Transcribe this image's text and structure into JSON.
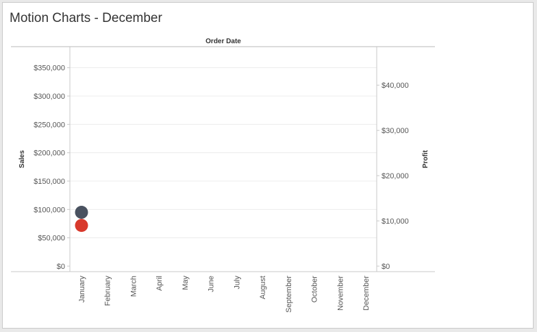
{
  "dashboard": {
    "title": "Motion Charts - December"
  },
  "chart_data": {
    "type": "scatter",
    "title": "",
    "top_label": "Order Date",
    "xlabel": "",
    "ylabel": "Sales",
    "y2label": "Profit",
    "categories": [
      "January",
      "February",
      "March",
      "April",
      "May",
      "June",
      "July",
      "August",
      "September",
      "October",
      "November",
      "December"
    ],
    "ylim": [
      0,
      375000
    ],
    "y2lim": [
      0,
      47000
    ],
    "y_ticks": [
      {
        "value": 0,
        "label": "$0"
      },
      {
        "value": 50000,
        "label": "$50,000"
      },
      {
        "value": 100000,
        "label": "$100,000"
      },
      {
        "value": 150000,
        "label": "$150,000"
      },
      {
        "value": 200000,
        "label": "$200,000"
      },
      {
        "value": 250000,
        "label": "$250,000"
      },
      {
        "value": 300000,
        "label": "$300,000"
      },
      {
        "value": 350000,
        "label": "$350,000"
      }
    ],
    "y2_ticks": [
      {
        "value": 0,
        "label": "$0"
      },
      {
        "value": 10000,
        "label": "$10,000"
      },
      {
        "value": 20000,
        "label": "$20,000"
      },
      {
        "value": 30000,
        "label": "$30,000"
      },
      {
        "value": 40000,
        "label": "$40,000"
      }
    ],
    "grid": true,
    "series": [
      {
        "measure": "Sales",
        "axis": "left",
        "color": "#4a5260",
        "points": [
          {
            "x": "January",
            "y": 95000
          }
        ]
      },
      {
        "measure": "Profit",
        "axis": "right",
        "color": "#d8392c",
        "points": [
          {
            "x": "January",
            "y": 9000
          }
        ]
      }
    ]
  }
}
